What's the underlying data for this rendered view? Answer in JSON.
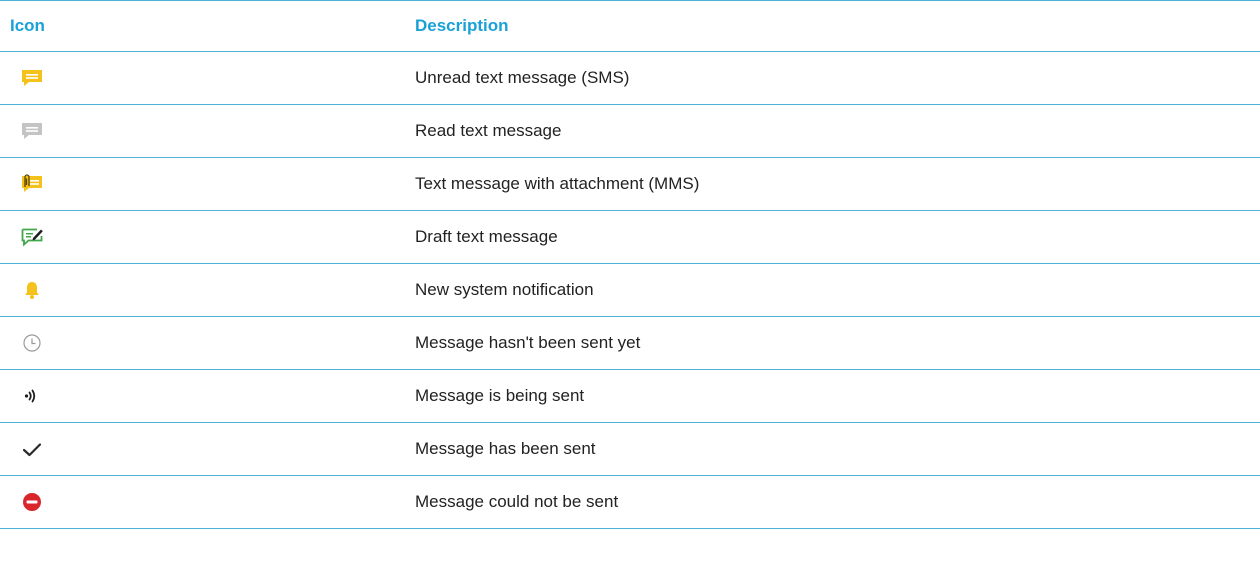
{
  "table": {
    "headers": {
      "icon": "Icon",
      "description": "Description"
    },
    "rows": [
      {
        "icon": "unread-sms-icon",
        "description": "Unread text message (SMS)"
      },
      {
        "icon": "read-sms-icon",
        "description": "Read text message"
      },
      {
        "icon": "mms-attachment-icon",
        "description": "Text message with attachment (MMS)"
      },
      {
        "icon": "draft-message-icon",
        "description": "Draft text message"
      },
      {
        "icon": "bell-icon",
        "description": "New system notification"
      },
      {
        "icon": "clock-icon",
        "description": "Message hasn't been sent yet"
      },
      {
        "icon": "sending-waves-icon",
        "description": "Message is being sent"
      },
      {
        "icon": "checkmark-icon",
        "description": "Message has been sent"
      },
      {
        "icon": "error-minus-icon",
        "description": "Message could not be sent"
      }
    ]
  },
  "colors": {
    "header_text": "#1aa1d8",
    "rule": "#4fb3d9",
    "unread_yellow": "#f5c21b",
    "read_grey": "#b9b9b9",
    "draft_green": "#3fa84a",
    "error_red": "#d9262c"
  }
}
